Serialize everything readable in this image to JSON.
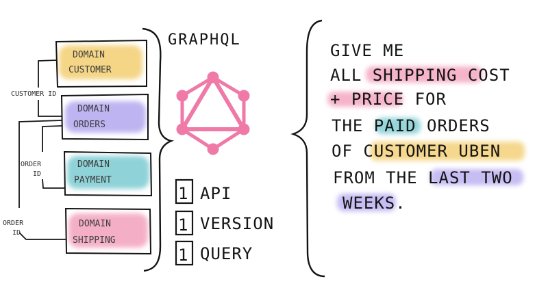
{
  "title": "GRAPHQL",
  "domains": [
    {
      "label": "DOMAIN CUSTOMER",
      "line1": "DOMAIN",
      "line2": "CUSTOMER",
      "color": "#f3cf72"
    },
    {
      "label": "DOMAIN ORDERS",
      "line1": "DOMAIN",
      "line2": "ORDERS",
      "color": "#b3a7ef"
    },
    {
      "label": "DOMAIN PAYMENT",
      "line1": "DOMAIN",
      "line2": "PAYMENT",
      "color": "#7ccbd1"
    },
    {
      "label": "DOMAIN SHIPPING",
      "line1": "DOMAIN",
      "line2": "SHIPPING",
      "color": "#f3a2bd"
    }
  ],
  "connectors": {
    "customer_id": "CUSTOMER ID",
    "order_id_1_line1": "ORDER",
    "order_id_1_line2": "ID",
    "order_id_2_line1": "ORDER",
    "order_id_2_line2": "ID"
  },
  "one_items": [
    {
      "number": "1",
      "label": "API"
    },
    {
      "number": "1",
      "label": "VERSION"
    },
    {
      "number": "1",
      "label": "QUERY"
    }
  ],
  "query_lines": [
    [
      "GIVE ME"
    ],
    [
      "ALL ",
      "SHIPPING COST"
    ],
    [
      "+ PRICE",
      " FOR"
    ],
    [
      "THE ",
      "PAID",
      " ",
      "ORDERS"
    ],
    [
      "OF ",
      "CUSTOMER UBEN"
    ],
    [
      "FROM THE ",
      "LAST TWO"
    ],
    [
      "WEEKS",
      "."
    ]
  ],
  "highlight_colors": {
    "pink": "#f3a2bd",
    "teal": "#7ccbd1",
    "yellow": "#f3cf72",
    "purple": "#b3a7ef"
  },
  "logo_color": "#ef7aa8"
}
